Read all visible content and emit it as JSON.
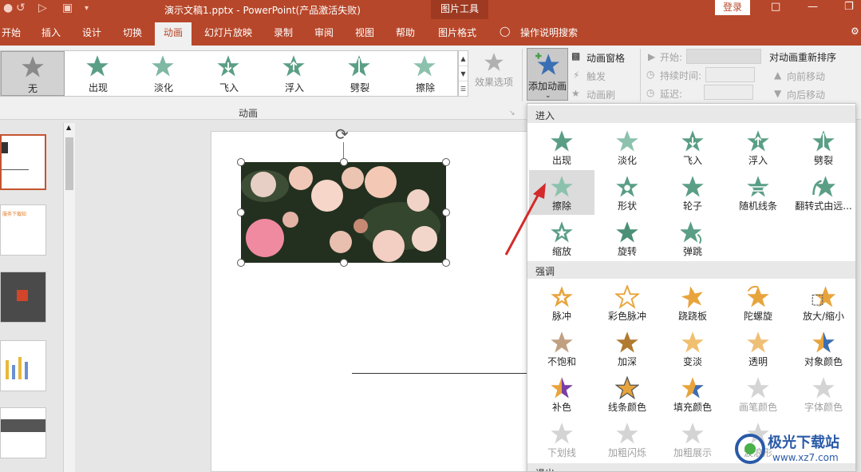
{
  "titlebar": {
    "title": "演示文稿1.pptx  -  PowerPoint(产品激活失败)",
    "context_tab": "图片工具",
    "login": "登录",
    "qa_icons": [
      "undo-icon",
      "redo-icon",
      "slideshow-icon",
      "print-preview-icon",
      "customize-icon"
    ],
    "window_icons": [
      "ribbon-display-icon",
      "minimize-icon",
      "close-icon"
    ]
  },
  "tabs": [
    "开始",
    "插入",
    "设计",
    "切换",
    "动画",
    "幻灯片放映",
    "录制",
    "审阅",
    "视图",
    "帮助",
    "图片格式",
    "操作说明搜索"
  ],
  "active_tab": "动画",
  "ribbon": {
    "gallery": [
      "无",
      "出现",
      "淡化",
      "飞入",
      "浮入",
      "劈裂",
      "擦除"
    ],
    "effect_options": "效果选项",
    "group_animation": "动画",
    "add_animation": "添加动画",
    "animation_pane": "动画窗格",
    "trigger": "触发",
    "animation_painter": "动画刷",
    "start_label": "开始:",
    "duration_label": "持续时间:",
    "delay_label": "延迟:",
    "reorder_title": "对动画重新排序",
    "move_earlier": "向前移动",
    "move_later": "向后移动"
  },
  "dropdown": {
    "section_entrance": "进入",
    "entrance": [
      "出现",
      "淡化",
      "飞入",
      "浮入",
      "劈裂",
      "擦除",
      "形状",
      "轮子",
      "随机线条",
      "翻转式由远...",
      "缩放",
      "旋转",
      "弹跳"
    ],
    "section_emphasis": "强调",
    "emphasis": [
      "脉冲",
      "彩色脉冲",
      "跷跷板",
      "陀螺旋",
      "放大/缩小",
      "不饱和",
      "加深",
      "变淡",
      "透明",
      "对象颜色",
      "补色",
      "线条颜色",
      "填充颜色",
      "画笔颜色",
      "字体颜色",
      "下划线",
      "加粗闪烁",
      "加粗展示",
      "波浪形"
    ],
    "section_exit": "退出"
  },
  "thumb_texts": {
    "slide2_title": "服务下载知"
  },
  "colors": {
    "brand": "#b7472a",
    "entrance_star": "#5a9e86",
    "emphasis_star": "#e8a43c",
    "disabled_star": "#c8c8c8",
    "arrow": "#d42a2a"
  },
  "watermark": {
    "name": "极光下载站",
    "url": "www.xz7.com"
  }
}
